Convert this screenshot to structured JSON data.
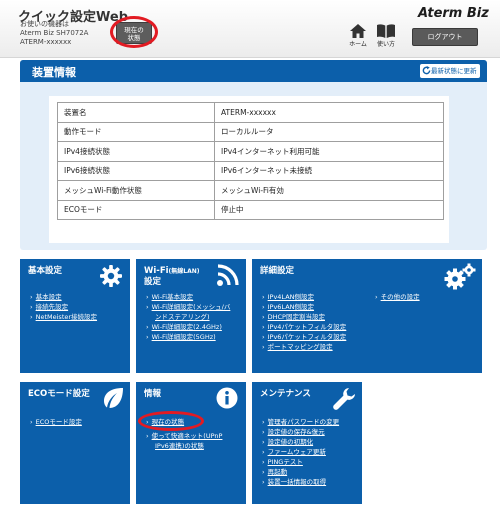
{
  "header": {
    "app_title": "クイック設定Web",
    "device_line1": "お使いの機器は",
    "device_line2": "Aterm Biz SH7072A",
    "device_line3": "ATERM-xxxxxx",
    "status_button_line1": "現在の",
    "status_button_line2": "状態",
    "brand": "Aterm Biz",
    "home_label": "ホーム",
    "guide_label": "使い方",
    "logout_label": "ログアウト",
    "highlight_color": "#e21b23"
  },
  "device_info": {
    "title": "装置情報",
    "refresh_label": "最新状態に更新",
    "rows": [
      {
        "label": "装置名",
        "value": "ATERM-xxxxxx"
      },
      {
        "label": "動作モード",
        "value": "ローカルルータ"
      },
      {
        "label": "IPv4接続状態",
        "value": "IPv4インターネット利用可能"
      },
      {
        "label": "IPv6接続状態",
        "value": "IPv6インターネット未接続"
      },
      {
        "label": "メッシュWi-Fi動作状態",
        "value": "メッシュWi-Fi有効"
      },
      {
        "label": "ECOモード",
        "value": "停止中"
      }
    ]
  },
  "tiles": {
    "basic": {
      "title": "基本設定",
      "icon": "gear-icon",
      "links": [
        "基本設定",
        "接続先設定",
        "NetMeister接続設定"
      ]
    },
    "wifi": {
      "title_main": "Wi-Fi",
      "title_small": "(無線LAN)",
      "title_line2": "設定",
      "icon": "wifi-icon",
      "links": [
        "Wi-Fi基本設定",
        "Wi-Fi詳細設定(メッシュ/バ",
        "ンドステアリング)",
        "Wi-Fi詳細設定(2.4GHz)",
        "Wi-Fi詳細設定(5GHz)"
      ]
    },
    "detail": {
      "title": "詳細設定",
      "icon": "gears-icon",
      "links_left": [
        "IPv4LAN側設定",
        "IPv6LAN側設定",
        "DHCP固定割当設定",
        "IPv4パケットフィルタ設定",
        "IPv6パケットフィルタ設定",
        "ポートマッピング設定"
      ],
      "links_right": [
        "その他の設定"
      ]
    },
    "eco": {
      "title": "ECOモード設定",
      "icon": "leaf-icon",
      "links": [
        "ECOモード設定"
      ]
    },
    "info": {
      "title": "情報",
      "icon": "info-icon",
      "links": [
        "現在の状態",
        "使って快適ネット(UPnP",
        "IPv6連携)の状態"
      ]
    },
    "maintenance": {
      "title": "メンテナンス",
      "icon": "wrench-icon",
      "links": [
        "管理者パスワードの変更",
        "設定値の保存&復元",
        "設定値の初期化",
        "ファームウェア更新",
        "PINGテスト",
        "再起動",
        "装置一括情報の取得"
      ]
    }
  },
  "colors": {
    "primary_blue": "#0c5faa",
    "panel_bg": "#e3eef9"
  }
}
